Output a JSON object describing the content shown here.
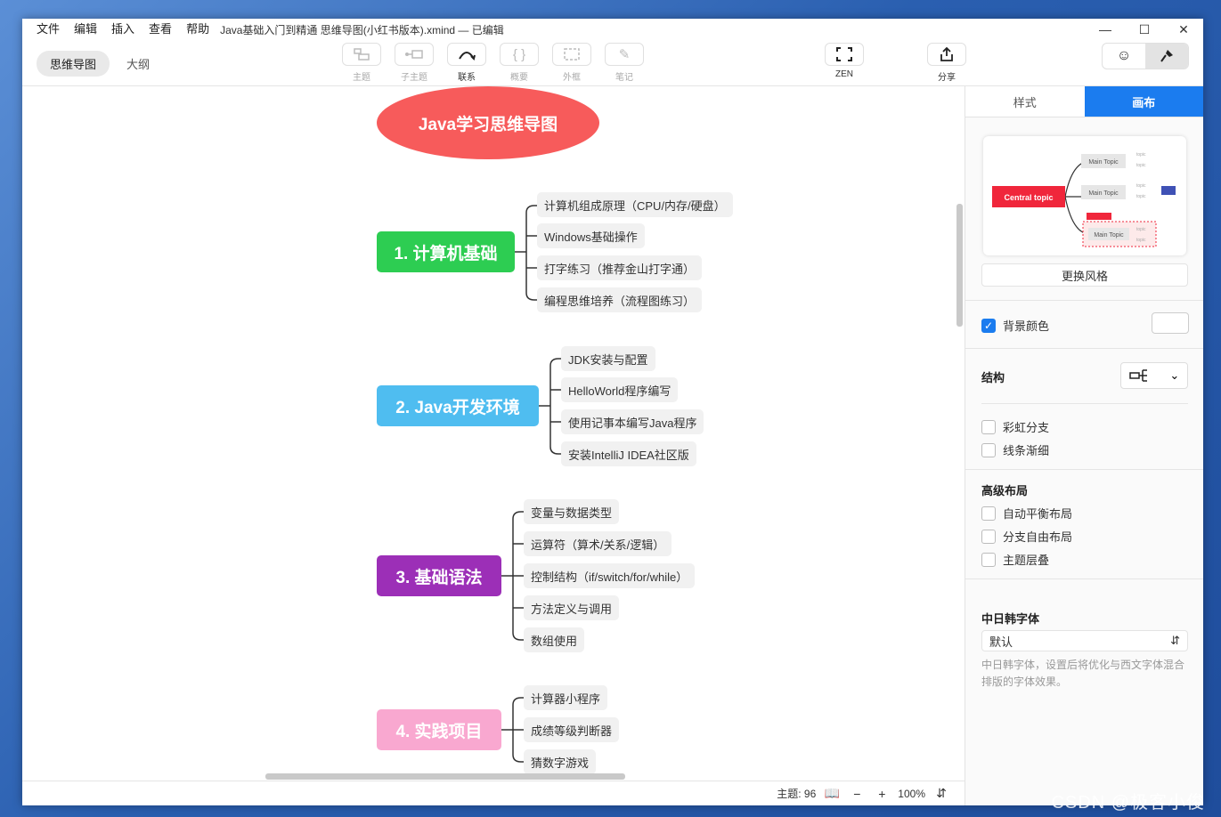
{
  "menu": [
    "文件",
    "编辑",
    "插入",
    "查看",
    "帮助"
  ],
  "document_title": "Java基础入门到精通 思维导图(小红书版本).xmind — 已编辑",
  "view_tabs": [
    "思维导图",
    "大纲"
  ],
  "tools": [
    {
      "label": "主题",
      "icon": "topic-icon",
      "enabled": false
    },
    {
      "label": "子主题",
      "icon": "subtopic-icon",
      "enabled": false
    },
    {
      "label": "联系",
      "icon": "relationship-icon",
      "enabled": true
    },
    {
      "label": "概要",
      "icon": "summary-icon",
      "enabled": false
    },
    {
      "label": "外框",
      "icon": "boundary-icon",
      "enabled": false
    },
    {
      "label": "笔记",
      "icon": "note-icon",
      "enabled": false
    },
    {
      "label": "ZEN",
      "icon": "zen-icon",
      "enabled": true
    },
    {
      "label": "分享",
      "icon": "share-icon",
      "enabled": true
    }
  ],
  "right_tools": [
    {
      "label": "图标",
      "icon": "smiley-icon"
    },
    {
      "label": "格式",
      "icon": "format-brush-icon"
    }
  ],
  "mindmap": {
    "central": "Java学习思维导图",
    "branches": [
      {
        "title": "1. 计算机基础",
        "color": "#2dcd52",
        "children": [
          "计算机组成原理（CPU/内存/硬盘）",
          "Windows基础操作",
          "打字练习（推荐金山打字通）",
          "编程思维培养（流程图练习）"
        ]
      },
      {
        "title": "2. Java开发环境",
        "color": "#4fbdf0",
        "children": [
          "JDK安装与配置",
          "HelloWorld程序编写",
          "使用记事本编写Java程序",
          "安装IntelliJ IDEA社区版"
        ]
      },
      {
        "title": "3. 基础语法",
        "color": "#9c2fb7",
        "children": [
          "变量与数据类型",
          "运算符（算术/关系/逻辑）",
          "控制结构（if/switch/for/while）",
          "方法定义与调用",
          "数组使用"
        ]
      },
      {
        "title": "4. 实践项目",
        "color": "#f9a8d0",
        "children": [
          "计算器小程序",
          "成绩等级判断器",
          "猜数字游戏"
        ]
      }
    ]
  },
  "status": {
    "topic_count": "主题: 96",
    "zoom": "100%"
  },
  "panel": {
    "tabs": [
      "样式",
      "画布"
    ],
    "active_tab": "画布",
    "preview": {
      "central": "Central topic",
      "main": "Main Topic",
      "sub": "topic"
    },
    "change_style": "更换风格",
    "background_color": {
      "label": "背景颜色",
      "checked": true
    },
    "structure": "结构",
    "options": [
      {
        "label": "彩虹分支",
        "checked": false
      },
      {
        "label": "线条渐细",
        "checked": false
      }
    ],
    "advanced_layout": "高级布局",
    "advanced_options": [
      {
        "label": "自动平衡布局",
        "checked": false
      },
      {
        "label": "分支自由布局",
        "checked": false
      },
      {
        "label": "主题层叠",
        "checked": false
      }
    ],
    "cjk_font": {
      "title": "中日韩字体",
      "value": "默认",
      "hint": "中日韩字体，设置后将优化与西文字体混合排版的字体效果。"
    }
  },
  "watermark": "CSDN @极客小俊"
}
